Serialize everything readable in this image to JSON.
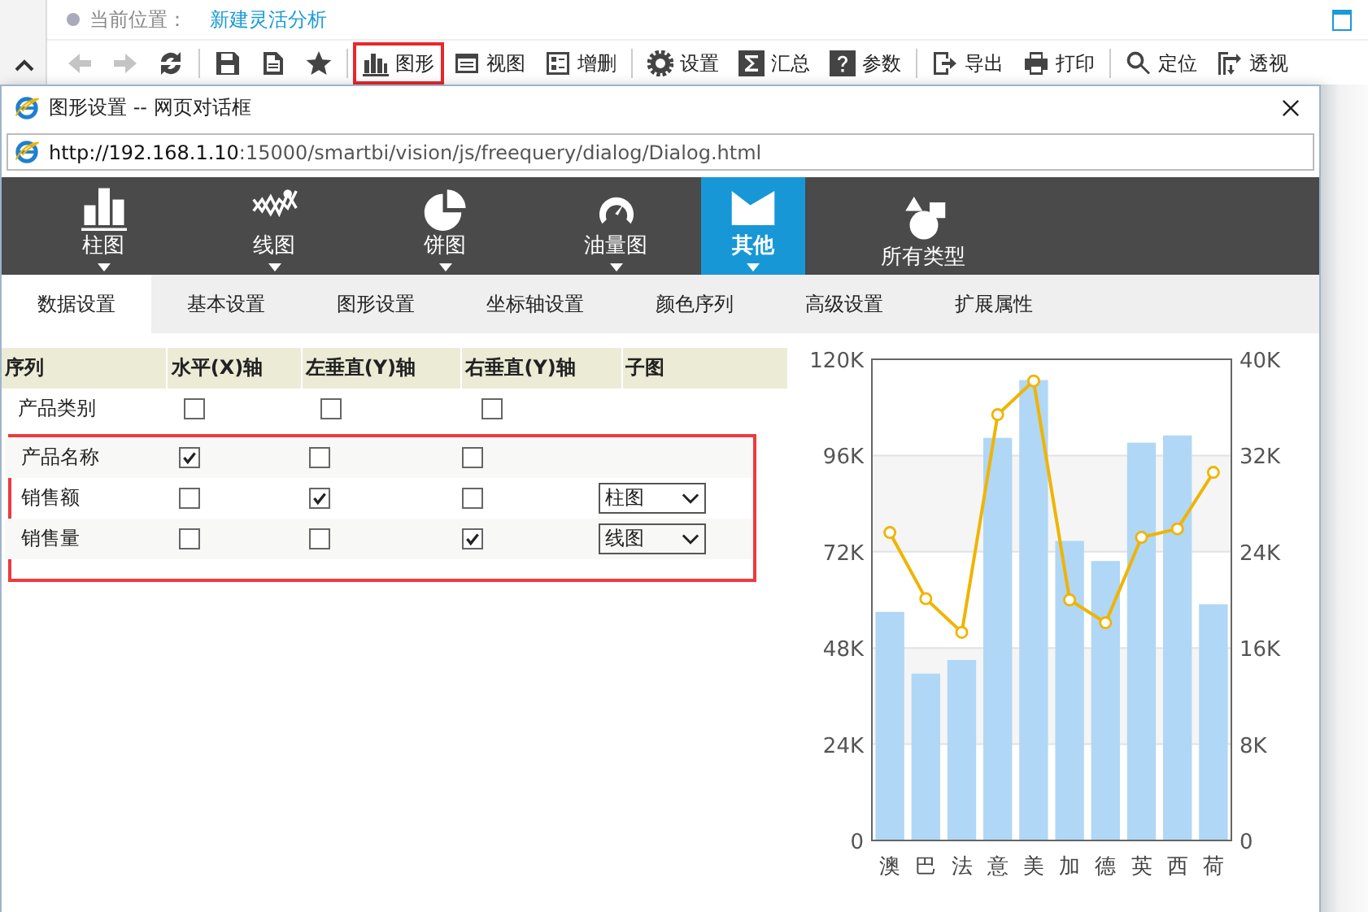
{
  "breadcrumb": {
    "label": "当前位置：",
    "link": "新建灵活分析"
  },
  "toolbar": [
    {
      "kind": "button",
      "disabled": true,
      "highlighted": false
    },
    {
      "kind": "button",
      "disabled": true,
      "highlighted": false
    },
    {
      "kind": "button",
      "disabled": false,
      "highlighted": false
    },
    {
      "kind": "separator"
    },
    {
      "kind": "button",
      "disabled": false,
      "highlighted": false
    },
    {
      "kind": "button",
      "disabled": false,
      "highlighted": false
    },
    {
      "kind": "button",
      "disabled": false,
      "highlighted": false
    },
    {
      "kind": "separator"
    },
    {
      "kind": "button",
      "label": "图形",
      "disabled": false,
      "highlighted": true
    },
    {
      "kind": "button",
      "label": "视图",
      "disabled": false,
      "highlighted": false
    },
    {
      "kind": "button",
      "label": "增删",
      "disabled": false,
      "highlighted": false
    },
    {
      "kind": "separator"
    },
    {
      "kind": "button",
      "label": "设置",
      "disabled": false,
      "highlighted": false
    },
    {
      "kind": "button",
      "label": "汇总",
      "disabled": false,
      "highlighted": false
    },
    {
      "kind": "button",
      "label": "参数",
      "disabled": false,
      "highlighted": false
    },
    {
      "kind": "separator"
    },
    {
      "kind": "button",
      "label": "导出",
      "disabled": false,
      "highlighted": false
    },
    {
      "kind": "button",
      "label": "打印",
      "disabled": false,
      "highlighted": false
    },
    {
      "kind": "separator"
    },
    {
      "kind": "button",
      "label": "定位",
      "disabled": false,
      "highlighted": false
    },
    {
      "kind": "button",
      "label": "透视",
      "disabled": false,
      "highlighted": false
    }
  ],
  "dialog": {
    "title": "图形设置 -- 网页对话框",
    "url_host": "http://192.168.1.10",
    "url_rest": ":15000/smartbi/vision/js/freequery/dialog/Dialog.html"
  },
  "chart_types": [
    {
      "label": "柱图",
      "has_menu": true,
      "selected": false
    },
    {
      "label": "线图",
      "has_menu": true,
      "selected": false
    },
    {
      "label": "饼图",
      "has_menu": true,
      "selected": false
    },
    {
      "label": "油量图",
      "has_menu": true,
      "selected": false
    },
    {
      "label": "其他",
      "has_menu": true,
      "selected": true
    },
    {
      "label": "所有类型",
      "has_menu": false,
      "selected": false
    }
  ],
  "tabs": [
    {
      "label": "数据设置",
      "selected": true
    },
    {
      "label": "基本设置",
      "selected": false
    },
    {
      "label": "图形设置",
      "selected": false
    },
    {
      "label": "坐标轴设置",
      "selected": false
    },
    {
      "label": "颜色序列",
      "selected": false
    },
    {
      "label": "高级设置",
      "selected": false
    },
    {
      "label": "扩展属性",
      "selected": false
    }
  ],
  "table": {
    "columns": [
      "序列",
      "水平(X)轴",
      "左垂直(Y)轴",
      "右垂直(Y)轴",
      "子图"
    ],
    "rows": [
      {
        "name": "产品类别",
        "x_axis": false,
        "left_y": false,
        "right_y": false,
        "highlighted": false
      },
      {
        "name": "产品名称",
        "x_axis": true,
        "left_y": false,
        "right_y": false,
        "highlighted": true
      },
      {
        "name": "销售额",
        "x_axis": false,
        "left_y": true,
        "right_y": false,
        "sub_chart": "柱图",
        "highlighted": true
      },
      {
        "name": "销售量",
        "x_axis": false,
        "left_y": false,
        "right_y": true,
        "sub_chart": "线图",
        "highlighted": true
      }
    ]
  },
  "chart_data": {
    "type": "bar",
    "grid": true,
    "categories": [
      "澳",
      "巴",
      "法",
      "意",
      "美",
      "加",
      "德",
      "英",
      "西",
      "荷"
    ],
    "ylim": [
      0,
      120000
    ],
    "y2lim": [
      0,
      40000
    ],
    "yticks": [
      {
        "value": 0,
        "label": "0"
      },
      {
        "value": 24000,
        "label": "24K"
      },
      {
        "value": 48000,
        "label": "48K"
      },
      {
        "value": 72000,
        "label": "72K"
      },
      {
        "value": 96000,
        "label": "96K"
      },
      {
        "value": 120000,
        "label": "120K"
      }
    ],
    "y2ticks": [
      {
        "value": 0,
        "label": "0"
      },
      {
        "value": 8000,
        "label": "8K"
      },
      {
        "value": 16000,
        "label": "16K"
      },
      {
        "value": 24000,
        "label": "24K"
      },
      {
        "value": 32000,
        "label": "32K"
      },
      {
        "value": 40000,
        "label": "40K"
      }
    ],
    "series": [
      {
        "type": "bar",
        "color": "#b0d7f5",
        "values": [
          57000,
          41600,
          45000,
          100400,
          114800,
          74700,
          69700,
          99200,
          101000,
          58900
        ]
      },
      {
        "type": "line",
        "axis": "y2",
        "marker": true,
        "color": "#f0b400",
        "values": [
          25600,
          20100,
          17300,
          35400,
          38200,
          20000,
          18100,
          25200,
          25900,
          30600
        ]
      }
    ]
  }
}
